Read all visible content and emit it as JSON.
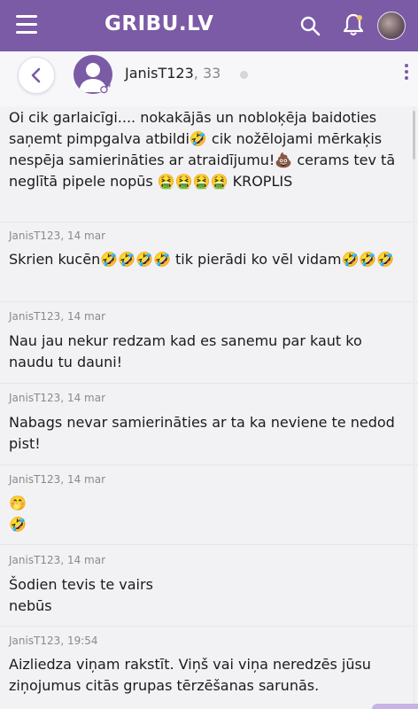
{
  "header": {
    "logo": "GRIBU.LV",
    "icons": [
      "menu-icon",
      "search-icon",
      "bell-icon",
      "profile-avatar"
    ],
    "accent": "#7b5aa6"
  },
  "chat": {
    "username": "JanisT123",
    "age_sep": ", 33",
    "gender_symbol": "♂",
    "status": "offline"
  },
  "messages": [
    {
      "time": "",
      "text": "Oi cik garlaicīgi.... nokakājās un nobloķēja baidoties saņemt pimpgalva atbildi🤣 cik nožēlojami mērkaķis nespēja samierināties ar atraidījumu!💩 cerams tev tā neglītā pipele nopūs 🤮🤮🤮🤮 KROPLIS"
    },
    {
      "time": "JanisT123, 14 mar",
      "text": "Skrien kucēn🤣🤣🤣🤣 tik pierādi ko vēl vidam🤣🤣🤣"
    },
    {
      "time": "JanisT123, 14 mar",
      "text": "Nau jau nekur redzam kad es sanemu par kaut ko naudu tu dauni!"
    },
    {
      "time": "JanisT123, 14 mar",
      "text": "Nabags nevar samierināties ar ta ka neviene te nedod pist!"
    },
    {
      "time": "JanisT123, 14 mar",
      "text": "🤭\n🤣"
    },
    {
      "time": "JanisT123, 14 mar",
      "text": "Šodien tevis te vairs\nnebūs"
    },
    {
      "time": "JanisT123, 19:54",
      "text": "Aizliedza viņam rakstīt. Viņš vai viņa neredzēs jūsu ziņojumus citās grupas tērzēšanas sarunās."
    }
  ]
}
